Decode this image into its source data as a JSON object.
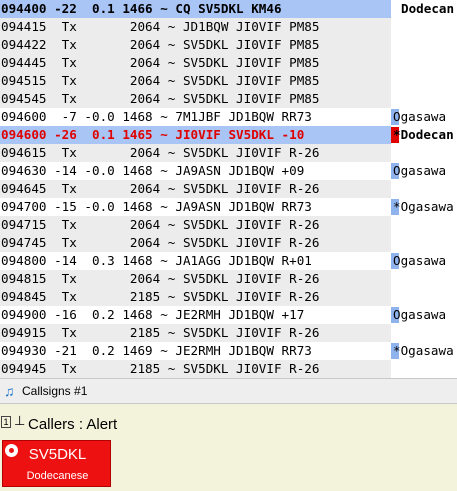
{
  "log": [
    {
      "kind": "cq",
      "msg": "094400 -22  0.1 1466 ~ CQ SV5DKL KM46",
      "country": "Dodecan",
      "flag": false
    },
    {
      "kind": "tx",
      "msg": "094415  Tx       2064 ~ JD1BQW JI0VIF PM85",
      "country": "",
      "flag": false
    },
    {
      "kind": "tx",
      "msg": "094422  Tx       2064 ~ SV5DKL JI0VIF PM85",
      "country": "",
      "flag": false
    },
    {
      "kind": "tx",
      "msg": "094445  Tx       2064 ~ SV5DKL JI0VIF PM85",
      "country": "",
      "flag": false
    },
    {
      "kind": "tx",
      "msg": "094515  Tx       2064 ~ SV5DKL JI0VIF PM85",
      "country": "",
      "flag": false
    },
    {
      "kind": "tx",
      "msg": "094545  Tx       2064 ~ SV5DKL JI0VIF PM85",
      "country": "",
      "flag": false
    },
    {
      "kind": "rx",
      "msg": "094600  -7 -0.0 1468 ~ 7M1JBF JD1BQW RR73",
      "country": "Ogasawa",
      "flag": true
    },
    {
      "kind": "hl",
      "msg": "094600 -26  0.1 1465 ~ JI0VIF SV5DKL -10",
      "country": "*Dodecan",
      "flag": false
    },
    {
      "kind": "tx",
      "msg": "094615  Tx       2064 ~ SV5DKL JI0VIF R-26",
      "country": "",
      "flag": false
    },
    {
      "kind": "rx",
      "msg": "094630 -14 -0.0 1468 ~ JA9ASN JD1BQW +09",
      "country": "Ogasawa",
      "flag": true
    },
    {
      "kind": "tx",
      "msg": "094645  Tx       2064 ~ SV5DKL JI0VIF R-26",
      "country": "",
      "flag": false
    },
    {
      "kind": "rx",
      "msg": "094700 -15 -0.0 1468 ~ JA9ASN JD1BQW RR73",
      "country": "*Ogasawa",
      "flag": true
    },
    {
      "kind": "tx",
      "msg": "094715  Tx       2064 ~ SV5DKL JI0VIF R-26",
      "country": "",
      "flag": false
    },
    {
      "kind": "tx",
      "msg": "094745  Tx       2064 ~ SV5DKL JI0VIF R-26",
      "country": "",
      "flag": false
    },
    {
      "kind": "rx",
      "msg": "094800 -14  0.3 1468 ~ JA1AGG JD1BQW R+01",
      "country": "Ogasawa",
      "flag": true
    },
    {
      "kind": "tx",
      "msg": "094815  Tx       2064 ~ SV5DKL JI0VIF R-26",
      "country": "",
      "flag": false
    },
    {
      "kind": "tx",
      "msg": "094845  Tx       2185 ~ SV5DKL JI0VIF R-26",
      "country": "",
      "flag": false
    },
    {
      "kind": "rx",
      "msg": "094900 -16  0.2 1468 ~ JE2RMH JD1BQW +17",
      "country": "Ogasawa",
      "flag": true
    },
    {
      "kind": "tx",
      "msg": "094915  Tx       2185 ~ SV5DKL JI0VIF R-26",
      "country": "",
      "flag": false
    },
    {
      "kind": "rx",
      "msg": "094930 -21  0.2 1469 ~ JE2RMH JD1BQW RR73",
      "country": "*Ogasawa",
      "flag": true
    },
    {
      "kind": "tx",
      "msg": "094945  Tx       2185 ~ SV5DKL JI0VIF R-26",
      "country": "",
      "flag": false
    }
  ],
  "tab": {
    "icon": "music-note-icon",
    "title": "Callsigns #1"
  },
  "panel": {
    "pin_label": "1",
    "title": "Callers : Alert"
  },
  "caller": {
    "callsign": "SV5DKL",
    "entity": "Dodecanese",
    "color": "#ee1111"
  },
  "colors": {
    "cq_bg": "#a9c5f5",
    "tx_bg": "#ececec",
    "alert_flag": "#e00000",
    "ogasawa_flag": "#8fb3ec"
  }
}
